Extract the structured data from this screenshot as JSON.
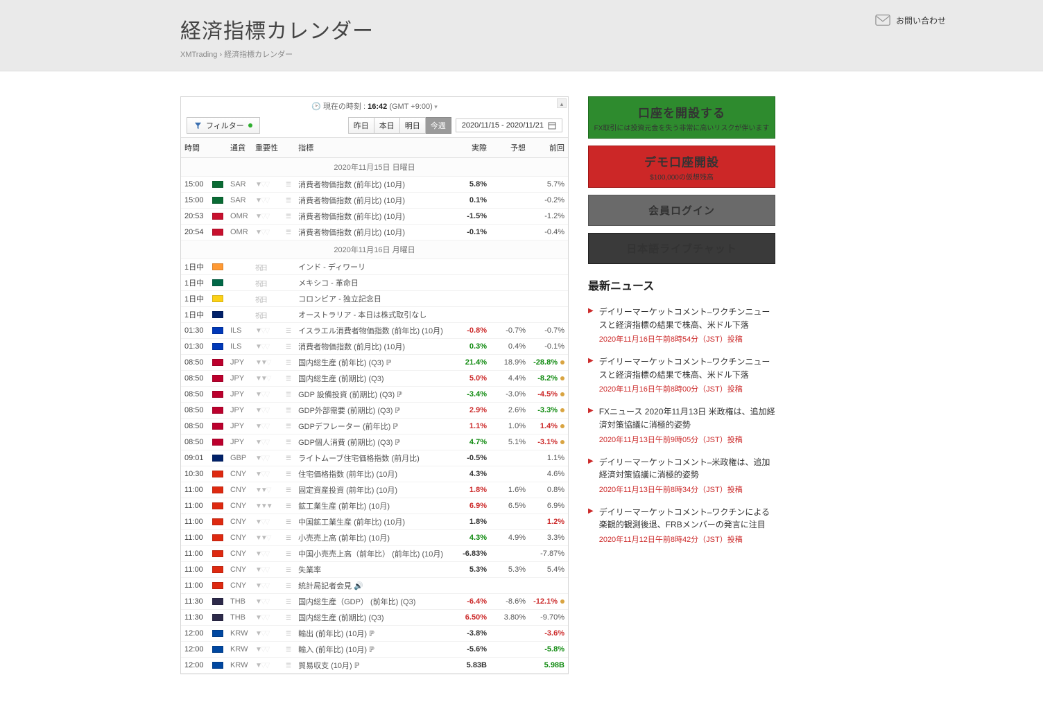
{
  "header": {
    "title": "経済指標カレンダー",
    "breadcrumb_root": "XMTrading",
    "breadcrumb_sep": "›",
    "breadcrumb_page": "経済指標カレンダー",
    "contact_label": "お問い合わせ"
  },
  "calendar": {
    "clock_prefix": "現在の時刻 :",
    "clock_time": "16:42",
    "clock_tz": "(GMT +9:00)",
    "filter_label": "フィルター",
    "range_buttons": {
      "yesterday": "昨日",
      "today": "本日",
      "tomorrow": "明日",
      "thisweek": "今週"
    },
    "date_range": "2020/11/15 - 2020/11/21",
    "columns": {
      "time": "時間",
      "currency": "通貨",
      "importance": "重要性",
      "indicator": "指標",
      "actual": "実際",
      "forecast": "予想",
      "previous": "前回"
    },
    "sections": [
      {
        "label": "2020年11月15日 日曜日",
        "rows": [
          {
            "time": "15:00",
            "cur": "SAR",
            "flag": "#0a6b34",
            "imp": 1,
            "ind": "消費者物価指数 (前年比) (10月)",
            "a": "5.8%",
            "ac": "neu",
            "f": "",
            "p": "5.7%"
          },
          {
            "time": "15:00",
            "cur": "SAR",
            "flag": "#0a6b34",
            "imp": 1,
            "ind": "消費者物価指数 (前月比) (10月)",
            "a": "0.1%",
            "ac": "neu",
            "f": "",
            "p": "-0.2%"
          },
          {
            "time": "20:53",
            "cur": "OMR",
            "flag": "#c8102e",
            "imp": 1,
            "ind": "消費者物価指数 (前年比) (10月)",
            "a": "-1.5%",
            "ac": "neu",
            "f": "",
            "p": "-1.2%"
          },
          {
            "time": "20:54",
            "cur": "OMR",
            "flag": "#c8102e",
            "imp": 1,
            "ind": "消費者物価指数 (前月比) (10月)",
            "a": "-0.1%",
            "ac": "neu",
            "f": "",
            "p": "-0.4%"
          }
        ]
      },
      {
        "label": "2020年11月16日 月曜日",
        "rows": [
          {
            "time": "1日中",
            "cur": "",
            "flag": "#ff9933",
            "holiday": true,
            "ind": "インド - ディワーリ"
          },
          {
            "time": "1日中",
            "cur": "",
            "flag": "#006847",
            "holiday": true,
            "ind": "メキシコ - 革命日"
          },
          {
            "time": "1日中",
            "cur": "",
            "flag": "#fcd116",
            "holiday": true,
            "ind": "コロンビア - 独立記念日"
          },
          {
            "time": "1日中",
            "cur": "",
            "flag": "#012169",
            "holiday": true,
            "ind": "オーストラリア - 本日は株式取引なし"
          },
          {
            "time": "01:30",
            "cur": "ILS",
            "flag": "#0038b8",
            "imp": 1,
            "ind": "イスラエル消費者物価指数 (前年比) (10月)",
            "a": "-0.8%",
            "ac": "neg",
            "f": "-0.7%",
            "p": "-0.7%"
          },
          {
            "time": "01:30",
            "cur": "ILS",
            "flag": "#0038b8",
            "imp": 1,
            "ind": "消費者物価指数 (前月比) (10月)",
            "a": "0.3%",
            "ac": "pos",
            "f": "0.4%",
            "p": "-0.1%"
          },
          {
            "time": "08:50",
            "cur": "JPY",
            "flag": "#bc002d",
            "imp": 2,
            "ind": "国内総生産 (前年比) (Q3) ℙ",
            "a": "21.4%",
            "ac": "pos",
            "f": "18.9%",
            "p": "-28.8%",
            "pc": "pos",
            "dot": true
          },
          {
            "time": "08:50",
            "cur": "JPY",
            "flag": "#bc002d",
            "imp": 2,
            "ind": "国内総生産 (前期比) (Q3)",
            "a": "5.0%",
            "ac": "neg",
            "f": "4.4%",
            "p": "-8.2%",
            "pc": "pos",
            "dot": true
          },
          {
            "time": "08:50",
            "cur": "JPY",
            "flag": "#bc002d",
            "imp": 1,
            "ind": "GDP 設備投資 (前期比) (Q3) ℙ",
            "a": "-3.4%",
            "ac": "pos",
            "f": "-3.0%",
            "p": "-4.5%",
            "pc": "neg",
            "dot": true
          },
          {
            "time": "08:50",
            "cur": "JPY",
            "flag": "#bc002d",
            "imp": 1,
            "ind": "GDP外部需要 (前期比) (Q3) ℙ",
            "a": "2.9%",
            "ac": "neg",
            "f": "2.6%",
            "p": "-3.3%",
            "pc": "pos",
            "dot": true
          },
          {
            "time": "08:50",
            "cur": "JPY",
            "flag": "#bc002d",
            "imp": 1,
            "ind": "GDPデフレーター (前年比) ℙ",
            "a": "1.1%",
            "ac": "neg",
            "f": "1.0%",
            "p": "1.4%",
            "pc": "neg",
            "dot": true
          },
          {
            "time": "08:50",
            "cur": "JPY",
            "flag": "#bc002d",
            "imp": 1,
            "ind": "GDP個人消費 (前期比) (Q3) ℙ",
            "a": "4.7%",
            "ac": "pos",
            "f": "5.1%",
            "p": "-3.1%",
            "pc": "neg",
            "dot": true
          },
          {
            "time": "09:01",
            "cur": "GBP",
            "flag": "#012169",
            "imp": 1,
            "ind": "ライトムーブ住宅価格指数 (前月比)",
            "a": "-0.5%",
            "ac": "neu",
            "f": "",
            "p": "1.1%"
          },
          {
            "time": "10:30",
            "cur": "CNY",
            "flag": "#de2910",
            "imp": 1,
            "ind": "住宅価格指数 (前年比) (10月)",
            "a": "4.3%",
            "ac": "neu",
            "f": "",
            "p": "4.6%"
          },
          {
            "time": "11:00",
            "cur": "CNY",
            "flag": "#de2910",
            "imp": 2,
            "ind": "固定資産投資 (前年比) (10月)",
            "a": "1.8%",
            "ac": "neg",
            "f": "1.6%",
            "p": "0.8%"
          },
          {
            "time": "11:00",
            "cur": "CNY",
            "flag": "#de2910",
            "imp": 3,
            "ind": "鉱工業生産 (前年比) (10月)",
            "a": "6.9%",
            "ac": "neg",
            "f": "6.5%",
            "p": "6.9%"
          },
          {
            "time": "11:00",
            "cur": "CNY",
            "flag": "#de2910",
            "imp": 1,
            "ind": "中国鉱工業生産 (前年比) (10月)",
            "a": "1.8%",
            "ac": "neu",
            "f": "",
            "p": "1.2%",
            "pc": "neg"
          },
          {
            "time": "11:00",
            "cur": "CNY",
            "flag": "#de2910",
            "imp": 2,
            "ind": "小売売上高 (前年比) (10月)",
            "a": "4.3%",
            "ac": "pos",
            "f": "4.9%",
            "p": "3.3%"
          },
          {
            "time": "11:00",
            "cur": "CNY",
            "flag": "#de2910",
            "imp": 1,
            "ind": "中国小売売上高（前年比） (前年比) (10月)",
            "a": "-6.83%",
            "ac": "neu",
            "f": "",
            "p": "-7.87%"
          },
          {
            "time": "11:00",
            "cur": "CNY",
            "flag": "#de2910",
            "imp": 1,
            "ind": "失業率",
            "a": "5.3%",
            "ac": "neu",
            "f": "5.3%",
            "p": "5.4%"
          },
          {
            "time": "11:00",
            "cur": "CNY",
            "flag": "#de2910",
            "imp": 1,
            "ind": "統計局記者会見 🔊",
            "a": "",
            "f": "",
            "p": ""
          },
          {
            "time": "11:30",
            "cur": "THB",
            "flag": "#2d2a4a",
            "imp": 1,
            "ind": "国内総生産（GDP） (前年比) (Q3)",
            "a": "-6.4%",
            "ac": "neg",
            "f": "-8.6%",
            "p": "-12.1%",
            "pc": "neg",
            "dot": true
          },
          {
            "time": "11:30",
            "cur": "THB",
            "flag": "#2d2a4a",
            "imp": 1,
            "ind": "国内総生産 (前期比) (Q3)",
            "a": "6.50%",
            "ac": "neg",
            "f": "3.80%",
            "p": "-9.70%"
          },
          {
            "time": "12:00",
            "cur": "KRW",
            "flag": "#0047a0",
            "imp": 1,
            "ind": "輸出 (前年比) (10月) ℙ",
            "a": "-3.8%",
            "ac": "neu",
            "f": "",
            "p": "-3.6%",
            "pc": "neg"
          },
          {
            "time": "12:00",
            "cur": "KRW",
            "flag": "#0047a0",
            "imp": 1,
            "ind": "輸入 (前年比) (10月) ℙ",
            "a": "-5.6%",
            "ac": "neu",
            "f": "",
            "p": "-5.8%",
            "pc": "pos"
          },
          {
            "time": "12:00",
            "cur": "KRW",
            "flag": "#0047a0",
            "imp": 1,
            "ind": "貿易収支 (10月) ℙ",
            "a": "5.83B",
            "ac": "neu",
            "f": "",
            "p": "5.98B",
            "pc": "pos"
          }
        ]
      }
    ],
    "holiday_label": "祝日"
  },
  "sidebar": {
    "open_title": "口座を開設する",
    "open_sub": "FX取引には投資元金を失う非常に高いリスクが伴います",
    "demo_title": "デモ口座開設",
    "demo_sub": "$100,000の仮想残高",
    "login_title": "会員ログイン",
    "chat_title": "日本語ライブチャット",
    "news_header": "最新ニュース",
    "news": [
      {
        "t": "デイリーマーケットコメント–ワクチンニュースと経済指標の結果で株高、米ドル下落",
        "m": "2020年11月16日午前8時54分（JST）投稿"
      },
      {
        "t": "デイリーマーケットコメント–ワクチンニュースと経済指標の結果で株高、米ドル下落",
        "m": "2020年11月16日午前8時00分（JST）投稿"
      },
      {
        "t": "FXニュース 2020年11月13日 米政権は、追加経済対策協議に消極的姿勢",
        "m": "2020年11月13日午前9時05分（JST）投稿"
      },
      {
        "t": "デイリーマーケットコメント–米政権は、追加経済対策協議に消極的姿勢",
        "m": "2020年11月13日午前8時34分（JST）投稿"
      },
      {
        "t": "デイリーマーケットコメント–ワクチンによる楽観的観測後退、FRBメンバーの発言に注目",
        "m": "2020年11月12日午前8時42分（JST）投稿"
      }
    ]
  }
}
